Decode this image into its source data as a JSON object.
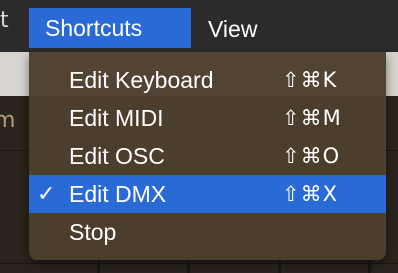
{
  "menubar": {
    "items": [
      {
        "label": "Shortcuts",
        "active": true
      },
      {
        "label": "View",
        "active": false
      }
    ]
  },
  "dropdown": {
    "items": [
      {
        "label": "Edit Keyboard",
        "shortcut": "⇧⌘K",
        "checked": false,
        "selected": false
      },
      {
        "label": "Edit MIDI",
        "shortcut": "⇧⌘M",
        "checked": false,
        "selected": false
      },
      {
        "label": "Edit OSC",
        "shortcut": "⇧⌘O",
        "checked": false,
        "selected": false
      },
      {
        "label": "Edit DMX",
        "shortcut": "⇧⌘X",
        "checked": true,
        "selected": true
      },
      {
        "label": "Stop",
        "shortcut": "",
        "checked": false,
        "selected": false
      }
    ],
    "check_glyph": "✓"
  },
  "colors": {
    "menubar": "#2b2b2b",
    "highlight": "#2a6ad6",
    "menu_bg": "#4d3f2c",
    "text": "#ffffff"
  }
}
